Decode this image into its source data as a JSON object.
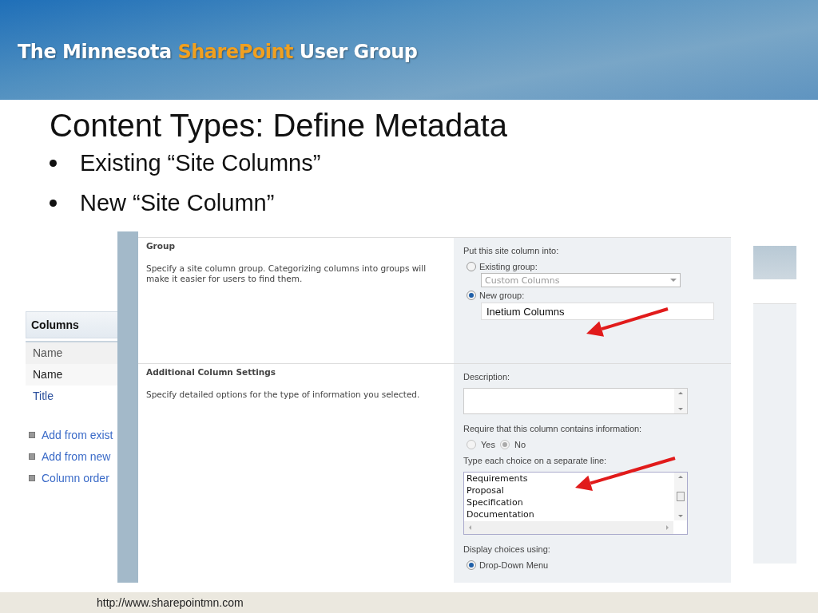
{
  "banner": {
    "segments": [
      {
        "text": "The Minnesota",
        "highlight": false
      },
      {
        "text": "SharePoint",
        "highlight": true
      },
      {
        "text": "User Group",
        "highlight": false
      }
    ]
  },
  "slide": {
    "title": "Content Types: Define Metadata",
    "bullets": [
      "Existing “Site Columns”",
      "New “Site Column”"
    ]
  },
  "columns_panel": {
    "heading": "Columns",
    "header_cell": "Name",
    "rows": [
      {
        "text": "Name",
        "kind": "plain"
      },
      {
        "text": "Title",
        "kind": "link"
      }
    ],
    "links": [
      "Add from exist",
      "Add from new",
      "Column order"
    ]
  },
  "form": {
    "sections": [
      {
        "title": "Group",
        "description": "Specify a site column group. Categorizing columns into groups will make it easier for users to find them."
      },
      {
        "title": "Additional Column Settings",
        "description": "Specify detailed options for the type of information you selected."
      }
    ],
    "group": {
      "label": "Put this site column into:",
      "options": [
        {
          "label": "Existing group:",
          "selected": false,
          "kind": "dropdown",
          "value": "Custom Columns"
        },
        {
          "label": "New group:",
          "selected": true,
          "kind": "text",
          "value": "Inetium Columns"
        }
      ]
    },
    "description_label": "Description:",
    "require_label": "Require that this column contains information:",
    "require_options": [
      {
        "label": "Yes",
        "selected": false
      },
      {
        "label": "No",
        "selected": true
      }
    ],
    "choices_label": "Type each choice on a separate line:",
    "choices": [
      "Requirements",
      "Proposal",
      "Specification",
      "Documentation"
    ],
    "display_label": "Display choices using:",
    "display_options": [
      {
        "label": "Drop-Down Menu",
        "selected": true
      }
    ]
  },
  "footer": {
    "url": "http://www.sharepointmn.com"
  }
}
